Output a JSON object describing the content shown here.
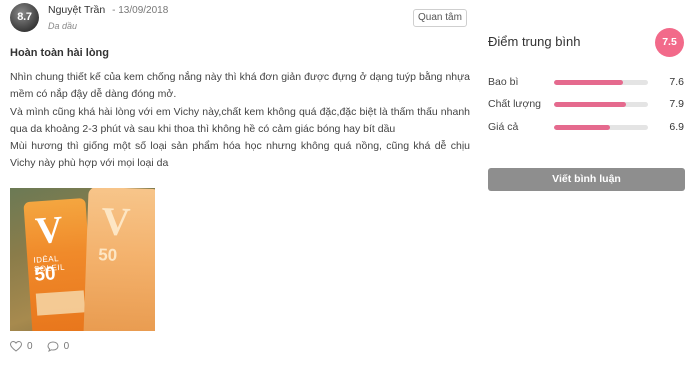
{
  "review": {
    "avatar_score": "8.7",
    "author": "Nguyệt Trần",
    "date": "- 13/09/2018",
    "skin_type": "Da dầu",
    "follow_label": "Quan tâm",
    "title": "Hoàn toàn hài lòng",
    "paragraphs": [
      "Nhìn chung thiết kế của kem chống nắng này thì khá đơn giản được đựng ở dạng tuýp bằng nhựa mềm có nắp đậy dễ dàng đóng mở.",
      "Và mình cũng khá hài lòng với em Vichy này,chất kem không quá đặc,đặc biệt là thấm thấu nhanh qua da khoảng 2-3 phút và sau khi thoa thì không hề có cảm giác bóng hay bít dầu",
      "Mùi hương thì giống một số loại sản phẩm hóa học nhưng không quá nồng, cũng khá dễ chịu Vichy này phù hợp với mọi loại da"
    ],
    "photo_text": {
      "brand_mark": "V",
      "line1": "IDÉAL SOLEIL",
      "spf": "50"
    },
    "likes": "0",
    "comments": "0"
  },
  "ratings": {
    "title": "Điểm trung bình",
    "average": "7.5",
    "items": [
      {
        "label": "Bao bì",
        "value": "7.6",
        "fill": 0.73
      },
      {
        "label": "Chất lượng",
        "value": "7.9",
        "fill": 0.77
      },
      {
        "label": "Giá cả",
        "value": "6.9",
        "fill": 0.6
      }
    ],
    "write_review_label": "Viết bình luận"
  },
  "colors": {
    "accent": "#f26a8a",
    "bar_fill": "#e56a8e",
    "button_gray": "#8e8e8e"
  },
  "icons": [
    "heart-icon",
    "comment-icon"
  ]
}
